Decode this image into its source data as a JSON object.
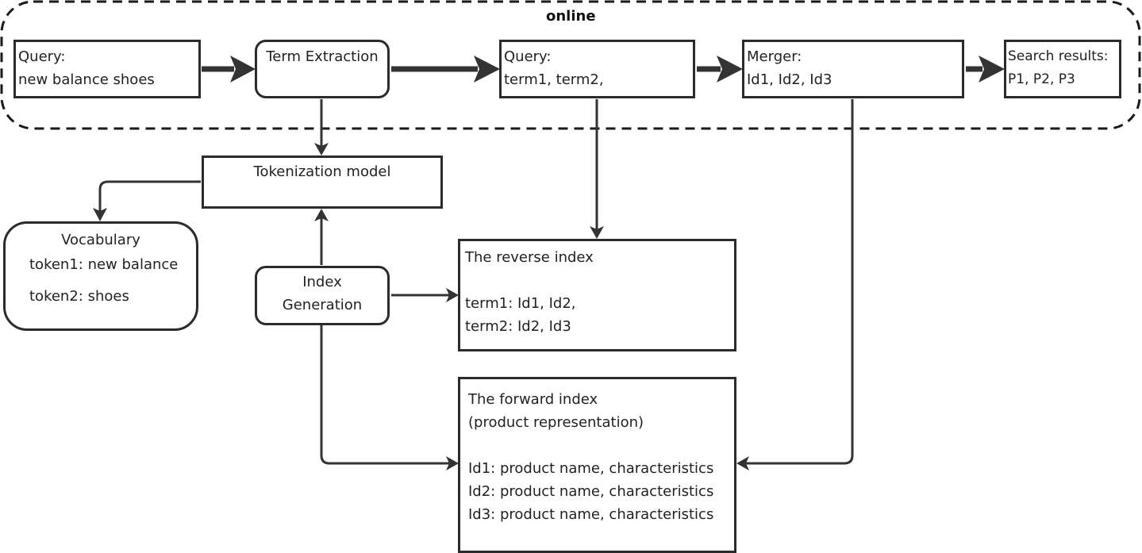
{
  "group": {
    "label": "online"
  },
  "nodes": {
    "query_input": {
      "lines": [
        "Query:",
        "new balance shoes"
      ]
    },
    "term_extraction": {
      "lines": [
        "Term Extraction"
      ]
    },
    "query_terms": {
      "lines": [
        "Query:",
        "term1, term2,"
      ]
    },
    "merger": {
      "lines": [
        "Merger:",
        "Id1, Id2, Id3"
      ]
    },
    "search_results": {
      "lines": [
        "Search results:",
        "P1, P2, P3"
      ]
    },
    "tokenization_model": {
      "lines": [
        "Tokenization model"
      ]
    },
    "vocabulary": {
      "title": "Vocabulary",
      "lines": [
        "token1: new balance",
        "token2: shoes"
      ]
    },
    "index_generation": {
      "lines": [
        "Index",
        "Generation"
      ]
    },
    "reverse_index": {
      "title": "The reverse index",
      "lines": [
        "term1: Id1, Id2,",
        "term2: Id2, Id3"
      ]
    },
    "forward_index": {
      "title": "The forward index",
      "subtitle": "(product representation)",
      "lines": [
        "Id1: product name, characteristics",
        "Id2: product name, characteristics",
        "Id3: product name, characteristics"
      ]
    }
  },
  "edges": [
    {
      "from": "query_input",
      "to": "term_extraction",
      "style": "thick"
    },
    {
      "from": "term_extraction",
      "to": "query_terms",
      "style": "thick"
    },
    {
      "from": "query_terms",
      "to": "merger",
      "style": "thick"
    },
    {
      "from": "merger",
      "to": "search_results",
      "style": "thick"
    },
    {
      "from": "term_extraction",
      "to": "tokenization_model",
      "style": "thin"
    },
    {
      "from": "tokenization_model",
      "to": "vocabulary",
      "style": "thin"
    },
    {
      "from": "index_generation",
      "to": "tokenization_model",
      "style": "thin"
    },
    {
      "from": "index_generation",
      "to": "reverse_index",
      "style": "thin"
    },
    {
      "from": "index_generation",
      "to": "forward_index",
      "style": "thin"
    },
    {
      "from": "query_terms",
      "to": "reverse_index",
      "style": "thin"
    },
    {
      "from": "merger",
      "to": "forward_index",
      "style": "thin"
    }
  ]
}
